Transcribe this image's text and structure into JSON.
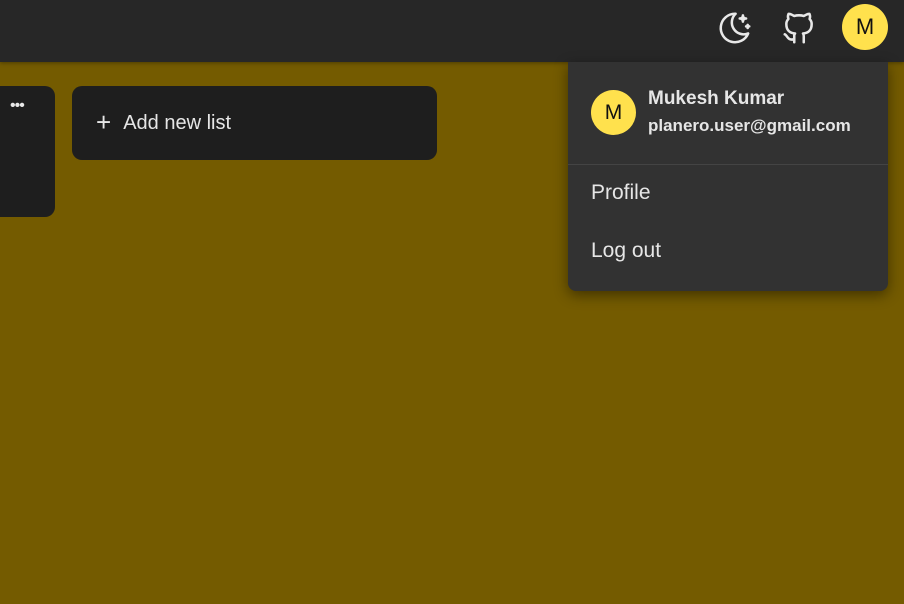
{
  "topbar": {
    "theme_icon": "moon-stars-icon",
    "github_icon": "github-icon",
    "avatar_initial": "M"
  },
  "board": {
    "list_menu_icon": "more-horizontal-icon",
    "list_menu_glyph": "•••",
    "add_list": {
      "icon": "plus-icon",
      "plus_glyph": "+",
      "label": "Add new list"
    }
  },
  "user_menu": {
    "avatar_initial": "M",
    "name": "Mukesh Kumar",
    "email": "planero.user@gmail.com",
    "items": [
      {
        "label": "Profile"
      },
      {
        "label": "Log out"
      }
    ]
  },
  "colors": {
    "board_background": "#745b00",
    "topbar_background": "#272727",
    "card_background": "#1e1e1e",
    "menu_background": "#323232",
    "avatar_accent": "#ffe14d"
  }
}
